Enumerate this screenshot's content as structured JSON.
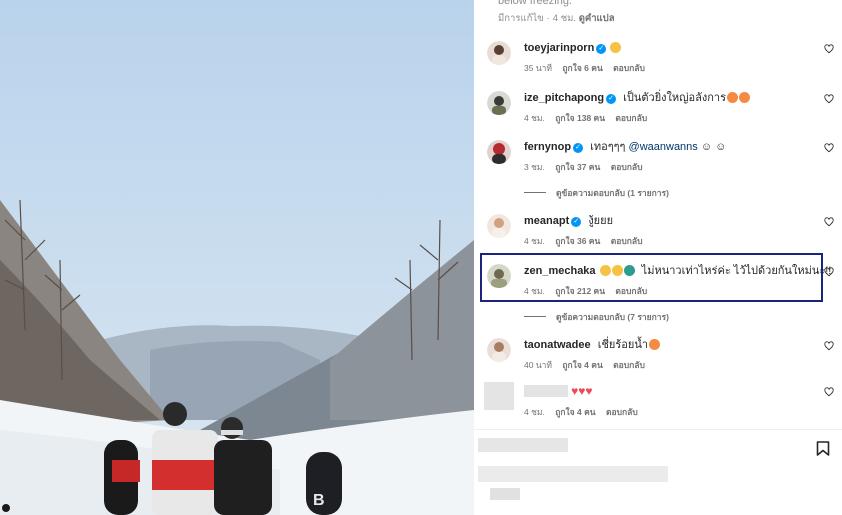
{
  "post": {
    "caption_tail": "below freezing.",
    "caption_meta": {
      "edited": "มีการแก้ไข",
      "time": "4 ชม.",
      "translate": "ดูคำแปล"
    }
  },
  "comments": [
    {
      "user": "toeyjarinporn",
      "verified": true,
      "text": "",
      "emojis": [
        "#f5c242"
      ],
      "time": "35 นาที",
      "likes": "ถูกใจ 6 คน",
      "reply": "ตอบกลับ"
    },
    {
      "user": "ize_pitchapong",
      "verified": true,
      "text": "เป็นตัวยิ่งใหญ่อลังการ",
      "emojis": [
        "#f58a42",
        "#f58a42"
      ],
      "time": "4 ชม.",
      "likes": "ถูกใจ 138 คน",
      "reply": "ตอบกลับ"
    },
    {
      "user": "fernynop",
      "verified": true,
      "text": "เทอๆๆๆ",
      "mention": "@waanwanns",
      "text2": "☺ ☺",
      "time": "3 ชม.",
      "likes": "ถูกใจ 37 คน",
      "reply": "ตอบกลับ"
    },
    {
      "user": "meanapt",
      "verified": true,
      "text": "งู้ยยย",
      "time": "4 ชม.",
      "likes": "ถูกใจ 36 คน",
      "reply": "ตอบกลับ"
    },
    {
      "user": "zen_mechaka",
      "verified": false,
      "text": "ไม่หนาวเท่าไหร่ค่ะ ไว้ไปด้วยกันใหม่นะ!!",
      "emojis": [
        "#f5c242",
        "#f5c242",
        "#2a9d8f"
      ],
      "time": "4 ชม.",
      "likes": "ถูกใจ 212 คน",
      "reply": "ตอบกลับ"
    },
    {
      "user": "taonatwadee",
      "verified": false,
      "text": "เชี่ยร้อยน้ำ",
      "emojis": [
        "#f58a42"
      ],
      "time": "40 นาที",
      "likes": "ถูกใจ 4 คน",
      "reply": "ตอบกลับ"
    },
    {
      "user": "",
      "verified": false,
      "text": "",
      "hearts": "♥♥♥",
      "time": "4 ชม.",
      "likes": "ถูกใจ 4 คน",
      "reply": "ตอบกลับ"
    }
  ],
  "view_replies": [
    {
      "label": "ดูข้อความตอบกลับ (1 รายการ)"
    },
    {
      "label": "ดูข้อความตอบกลับ (7 รายการ)"
    }
  ],
  "colors": {
    "verified": "#0095f6",
    "highlight_border": "#1a237e",
    "heart_red": "#ed4956"
  },
  "icons": {
    "like": "heart-outline-icon",
    "save": "bookmark-icon"
  }
}
